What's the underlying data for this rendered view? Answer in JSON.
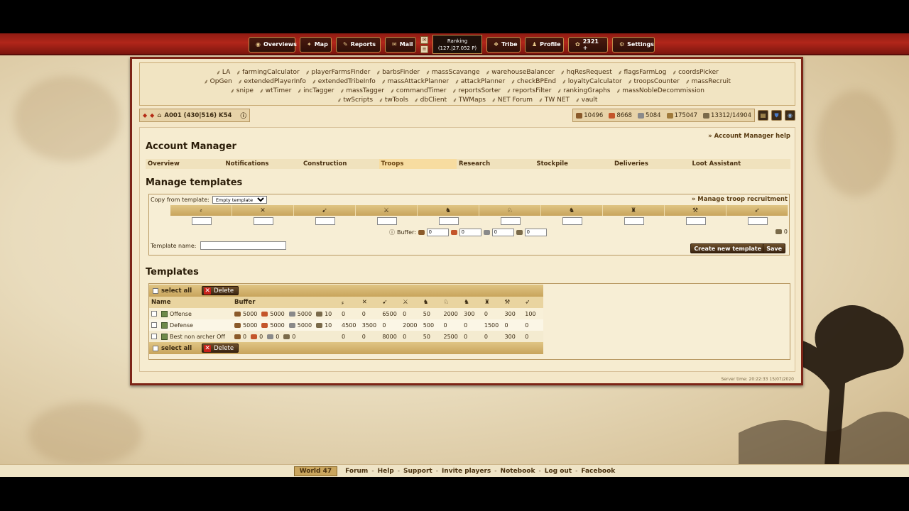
{
  "topbar": {
    "buttons": [
      {
        "label": "Overviews",
        "icon": "overviews-icon",
        "glyph": "◉"
      },
      {
        "label": "Map",
        "icon": "map-icon",
        "glyph": "✦"
      },
      {
        "label": "Reports",
        "icon": "reports-icon",
        "glyph": "✎"
      },
      {
        "label": "Mail",
        "icon": "mail-icon",
        "glyph": "✉"
      }
    ],
    "ranking_label": "Ranking",
    "ranking_value": "(127.|27.052 P)",
    "buttons_right": [
      {
        "label": "Tribe",
        "icon": "tribe-icon",
        "glyph": "❖"
      },
      {
        "label": "Profile",
        "icon": "profile-icon",
        "glyph": "♟"
      },
      {
        "label": "2321 +",
        "icon": "premium-icon",
        "glyph": "✿"
      },
      {
        "label": "Settings",
        "icon": "settings-icon",
        "glyph": "⚙"
      }
    ]
  },
  "quickbar": {
    "rows": [
      [
        "LA",
        "farmingCalculator",
        "playerFarmsFinder",
        "barbsFinder",
        "massScavange",
        "warehouseBalancer",
        "hqResRequest",
        "flagsFarmLog",
        "coordsPicker"
      ],
      [
        "OpGen",
        "extendedPlayerInfo",
        "extendedTribeInfo",
        "massAttackPlanner",
        "attackPlanner",
        "checkBPEnd",
        "loyaltyCalculator",
        "troopsCounter",
        "massRecruit"
      ],
      [
        "snipe",
        "wtTimer",
        "incTagger",
        "massTagger",
        "commandTimer",
        "reportsSorter",
        "reportsFilter",
        "rankingGraphs",
        "massNobleDecommission"
      ],
      [
        "twScripts",
        "twTools",
        "dbClient",
        "TWMaps",
        "NET Forum",
        "TW NET",
        "vault"
      ]
    ]
  },
  "village": {
    "name": "A001  (430|516) K54"
  },
  "resources": {
    "wood": "10496",
    "clay": "8668",
    "iron": "5084",
    "storage": "175047",
    "population": "13312/14904"
  },
  "page": {
    "help_link": "» Account Manager help",
    "title": "Account Manager",
    "tabs": [
      "Overview",
      "Notifications",
      "Construction",
      "Troops",
      "Research",
      "Stockpile",
      "Deliveries",
      "Loot Assistant"
    ],
    "active_tab": "Troops",
    "manage_title": "Manage templates",
    "templates_title": "Templates"
  },
  "manage": {
    "copy_label": "Copy from template:",
    "copy_value": "Empty template",
    "recruit_link": "» Manage troop recruitment",
    "unit_glyphs": [
      "⸗",
      "✕",
      "➹",
      "⚔",
      "♞",
      "♘",
      "♞",
      "♜",
      "⚒",
      "➶"
    ],
    "buffer_label": "Buffer:",
    "buffer_values": [
      "0",
      "0",
      "0",
      "0"
    ],
    "pop_value": "0",
    "template_name_label": "Template name:",
    "create_button": "Create new template",
    "save_button": "Save"
  },
  "templates": {
    "select_all": "select all",
    "delete_button": "Delete",
    "col_name": "Name",
    "col_buffer": "Buffer",
    "rows": [
      {
        "name": "Offense",
        "buffer": [
          "5000",
          "5000",
          "5000",
          "10"
        ],
        "units": [
          "0",
          "0",
          "6500",
          "0",
          "50",
          "2000",
          "300",
          "0",
          "300",
          "100"
        ]
      },
      {
        "name": "Defense",
        "buffer": [
          "5000",
          "5000",
          "5000",
          "10"
        ],
        "units": [
          "4500",
          "3500",
          "0",
          "2000",
          "500",
          "0",
          "0",
          "1500",
          "0",
          "0"
        ]
      },
      {
        "name": "Best non archer Off",
        "buffer": [
          "0",
          "0",
          "0",
          "0"
        ],
        "units": [
          "0",
          "0",
          "8000",
          "0",
          "50",
          "2500",
          "0",
          "0",
          "300",
          "0"
        ]
      }
    ]
  },
  "server_time": "Server time: 20:22:33 15/07/2020",
  "footer": {
    "world": "World 47",
    "links": [
      "Forum",
      "Help",
      "Support",
      "Invite players",
      "Notebook",
      "Log out",
      "Facebook"
    ]
  },
  "colors": {
    "topbar_red": "#b1261a",
    "frame_border": "#7d2416",
    "header_gold": "#c8a45c",
    "wood": "#8a5a2a",
    "clay": "#c4552a",
    "iron": "#8a8a8a"
  }
}
